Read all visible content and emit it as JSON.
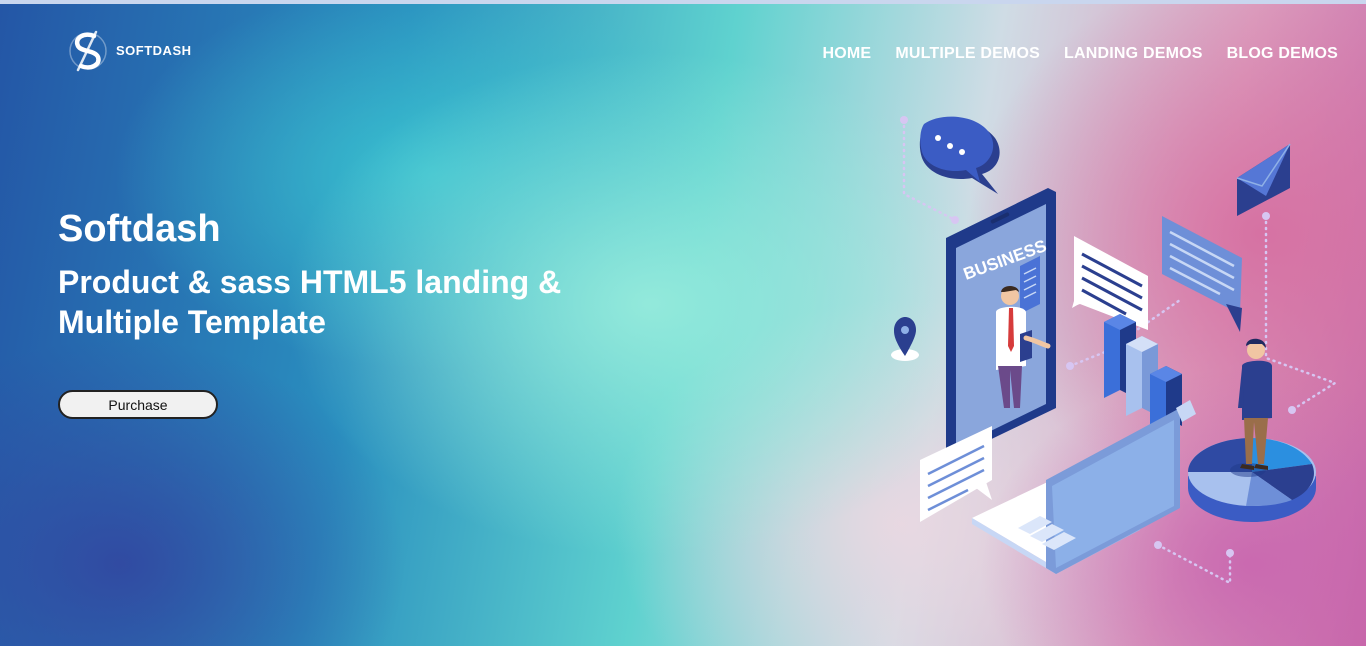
{
  "brand": {
    "name": "SOFTDASH"
  },
  "nav": {
    "items": [
      {
        "label": "HOME"
      },
      {
        "label": "MULTIPLE DEMOS"
      },
      {
        "label": "LANDING DEMOS"
      },
      {
        "label": "BLOG DEMOS"
      }
    ]
  },
  "hero": {
    "title": "Softdash",
    "subtitle": "Product & sass HTML5 landing & Multiple Template",
    "button_label": "Purchase"
  },
  "illustration": {
    "screen_label": "BUSINESS",
    "icons": [
      "chat-bubble-icon",
      "envelope-icon",
      "location-pin-icon",
      "pie-chart-icon",
      "bar-chart-icon",
      "laptop-icon",
      "phone-icon"
    ]
  },
  "colors": {
    "primary_dark": "#2b3f8f",
    "primary_blue": "#3b6fd9",
    "light_blue": "#8fb0e6",
    "white": "#ffffff"
  }
}
